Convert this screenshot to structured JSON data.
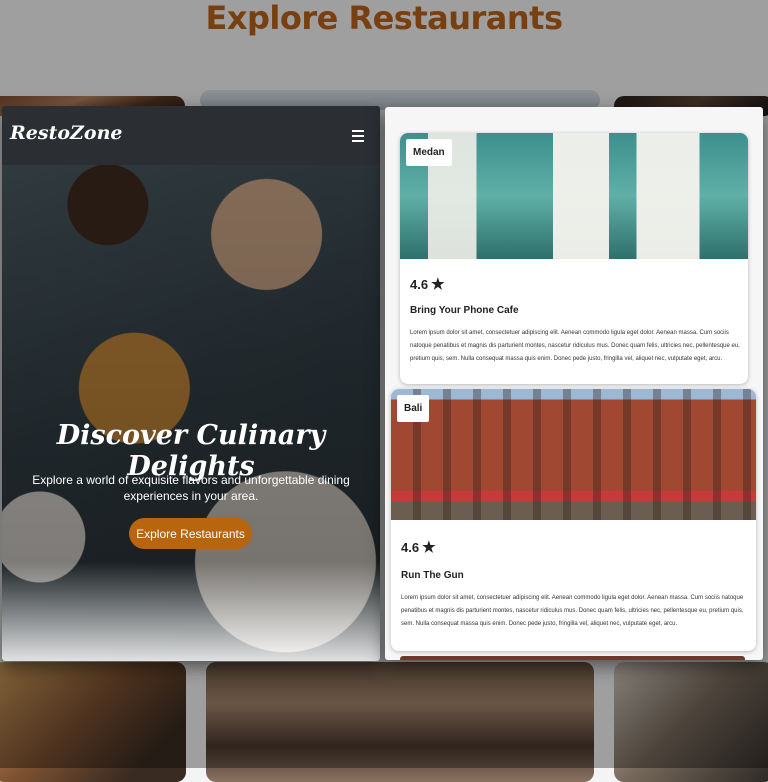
{
  "background_page": {
    "title": "Explore Restaurants"
  },
  "left_screen": {
    "nav": {
      "logo": "RestoZone",
      "menu_icon": "hamburger-icon"
    },
    "hero": {
      "title": "Discover Culinary Delights",
      "subtitle": "Explore a world of exquisite flavors and unforgettable dining experiences in your area.",
      "cta_label": "Explore Restaurants",
      "cta_color": "#b8650f"
    }
  },
  "right_screen": {
    "cards": [
      {
        "city": "Medan",
        "rating": "4.6",
        "rating_icon": "star-icon",
        "name": "Bring Your Phone Cafe",
        "description": "Lorem ipsum dolor sit amet, consectetuer adipiscing elit. Aenean commodo ligula eget dolor. Aenean massa. Cum sociis natoque penatibus et magnis dis parturient montes, nascetur ridiculus mus. Donec quam felis, ultricies nec, pellentesque eu, pretium quis, sem. Nulla consequat massa quis enim. Donec pede justo, fringilla vel, aliquet nec, vulputate eget, arcu."
      },
      {
        "city": "Bali",
        "rating": "4.6",
        "rating_icon": "star-icon",
        "name": "Run The Gun",
        "description": "Lorem ipsum dolor sit amet, consectetuer adipiscing elit. Aenean commodo ligula eget dolor. Aenean massa. Cum sociis natoque penatibus et magnis dis parturient montes, nascetur ridiculus mus. Donec quam felis, ultricies nec, pellentesque eu, pretium quis, sem. Nulla consequat massa quis enim. Donec pede justo, fringilla vel, aliquet nec, vulputate eget, arcu."
      }
    ]
  },
  "colors": {
    "accent": "#b8650f",
    "nav_background": "#2b2f33",
    "title_color": "#b8631a"
  }
}
